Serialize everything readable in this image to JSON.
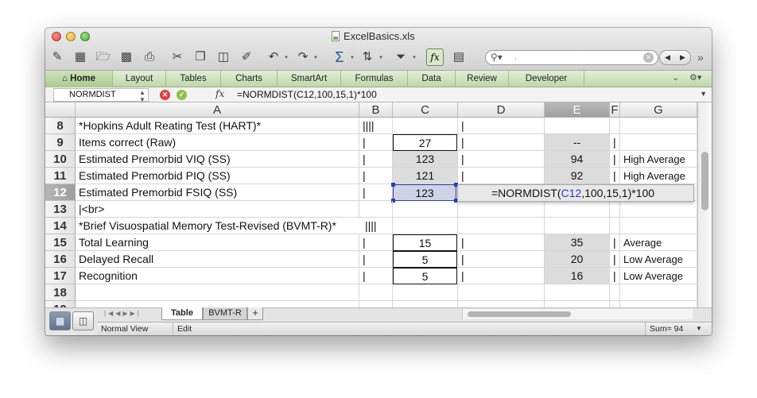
{
  "window": {
    "title": "ExcelBasics.xls"
  },
  "toolbar": {
    "icons": [
      "new-icon",
      "templates-icon",
      "open-icon",
      "save-icon",
      "print-icon",
      "cut-icon",
      "copy-icon",
      "paste-icon",
      "format-brush-icon",
      "undo-icon",
      "redo-icon",
      "autosum-icon",
      "sort-icon",
      "filter-icon",
      "formula-builder-icon",
      "media-icon"
    ],
    "search_value": "."
  },
  "ribbon": {
    "tabs": [
      "Home",
      "Layout",
      "Tables",
      "Charts",
      "SmartArt",
      "Formulas",
      "Data",
      "Review",
      "Developer"
    ]
  },
  "formula_bar": {
    "name_box": "NORMDIST",
    "fx_label": "fx",
    "formula": "=NORMDIST(C12,100,15,1)*100"
  },
  "columns": [
    "A",
    "B",
    "C",
    "D",
    "E",
    "F",
    "G"
  ],
  "rows": [
    {
      "n": "8",
      "a": "*Hopkins Adult Reating Test (HART)*",
      "b": "||||",
      "c": "",
      "d": "|",
      "e": "",
      "f": "",
      "g": ""
    },
    {
      "n": "9",
      "a": "Items correct (Raw)",
      "b": "|",
      "c": "27",
      "d": "|",
      "e": "--",
      "f": "|",
      "g": ""
    },
    {
      "n": "10",
      "a": "Estimated Premorbid VIQ (SS)",
      "b": "|",
      "c": "123",
      "d": "|",
      "e": "94",
      "f": "|",
      "g": "High Average"
    },
    {
      "n": "11",
      "a": "Estimated Premorbid PIQ (SS)",
      "b": "|",
      "c": "121",
      "d": "|",
      "e": "92",
      "f": "|",
      "g": "High Average"
    },
    {
      "n": "12",
      "a": "Estimated Premorbid FSIQ (SS)",
      "b": "|",
      "c": "123",
      "d": "",
      "e": "",
      "f": "",
      "g": ""
    },
    {
      "n": "13",
      "a": "|<br>",
      "b": "",
      "c": "",
      "d": "",
      "e": "",
      "f": "",
      "g": ""
    },
    {
      "n": "14",
      "a": "*Brief Visuospatial Memory Test-Revised (BVMT-R)*",
      "b": "||||",
      "c": "",
      "d": "",
      "e": "",
      "f": "",
      "g": ""
    },
    {
      "n": "15",
      "a": "Total Learning",
      "b": "|",
      "c": "15",
      "d": "|",
      "e": "35",
      "f": "|",
      "g": "Average"
    },
    {
      "n": "16",
      "a": "Delayed Recall",
      "b": "|",
      "c": "5",
      "d": "|",
      "e": "20",
      "f": "|",
      "g": "Low Average"
    },
    {
      "n": "17",
      "a": "Recognition",
      "b": "|",
      "c": "5",
      "d": "|",
      "e": "16",
      "f": "|",
      "g": "Low Average"
    },
    {
      "n": "18",
      "a": "",
      "b": "",
      "c": "",
      "d": "",
      "e": "",
      "f": "",
      "g": ""
    },
    {
      "n": "19",
      "a": "",
      "b": "",
      "c": "",
      "d": "",
      "e": "",
      "f": "",
      "g": ""
    }
  ],
  "edit_tooltip": {
    "prefix": "=NORMDIST(",
    "ref": "C12",
    "suffix": ",100,15,1)*100"
  },
  "sheets": {
    "tabs": [
      "Table",
      "BVMT-R"
    ],
    "add": "+"
  },
  "status": {
    "view": "Normal View",
    "mode": "Edit",
    "sum": "Sum= 94"
  }
}
